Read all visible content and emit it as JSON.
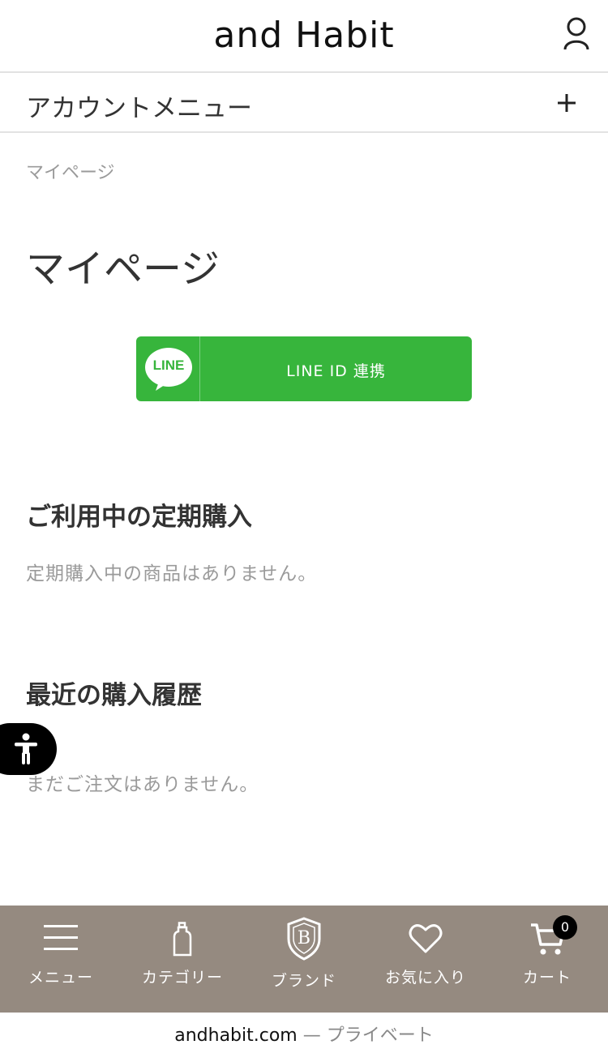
{
  "header": {
    "logo_text": "and Habit",
    "user_icon": "user-icon"
  },
  "account_menu": {
    "label": "アカウントメニュー",
    "toggle_icon": "plus-icon"
  },
  "breadcrumb": "マイページ",
  "page_title": "マイページ",
  "line_button": {
    "logo_text": "LINE",
    "label": "LINE ID 連携",
    "color": "#37b53c"
  },
  "subscriptions": {
    "title": "ご利用中の定期購入",
    "empty_text": "定期購入中の商品はありません。"
  },
  "recent_orders": {
    "title": "最近の購入履歴",
    "empty_text": "まだご注文はありません。"
  },
  "accessibility_button": {
    "icon": "accessibility-icon"
  },
  "bottom_nav": {
    "background": "#958a80",
    "items": [
      {
        "label": "メニュー",
        "icon": "hamburger-icon"
      },
      {
        "label": "カテゴリー",
        "icon": "bottle-icon"
      },
      {
        "label": "ブランド",
        "icon": "brand-shield-icon",
        "icon_letter": "B"
      },
      {
        "label": "お気に入り",
        "icon": "heart-icon"
      },
      {
        "label": "カート",
        "icon": "cart-icon",
        "badge": "0"
      }
    ]
  },
  "url_bar": {
    "domain": "andhabit.com",
    "separator": "—",
    "mode": "プライベート"
  }
}
